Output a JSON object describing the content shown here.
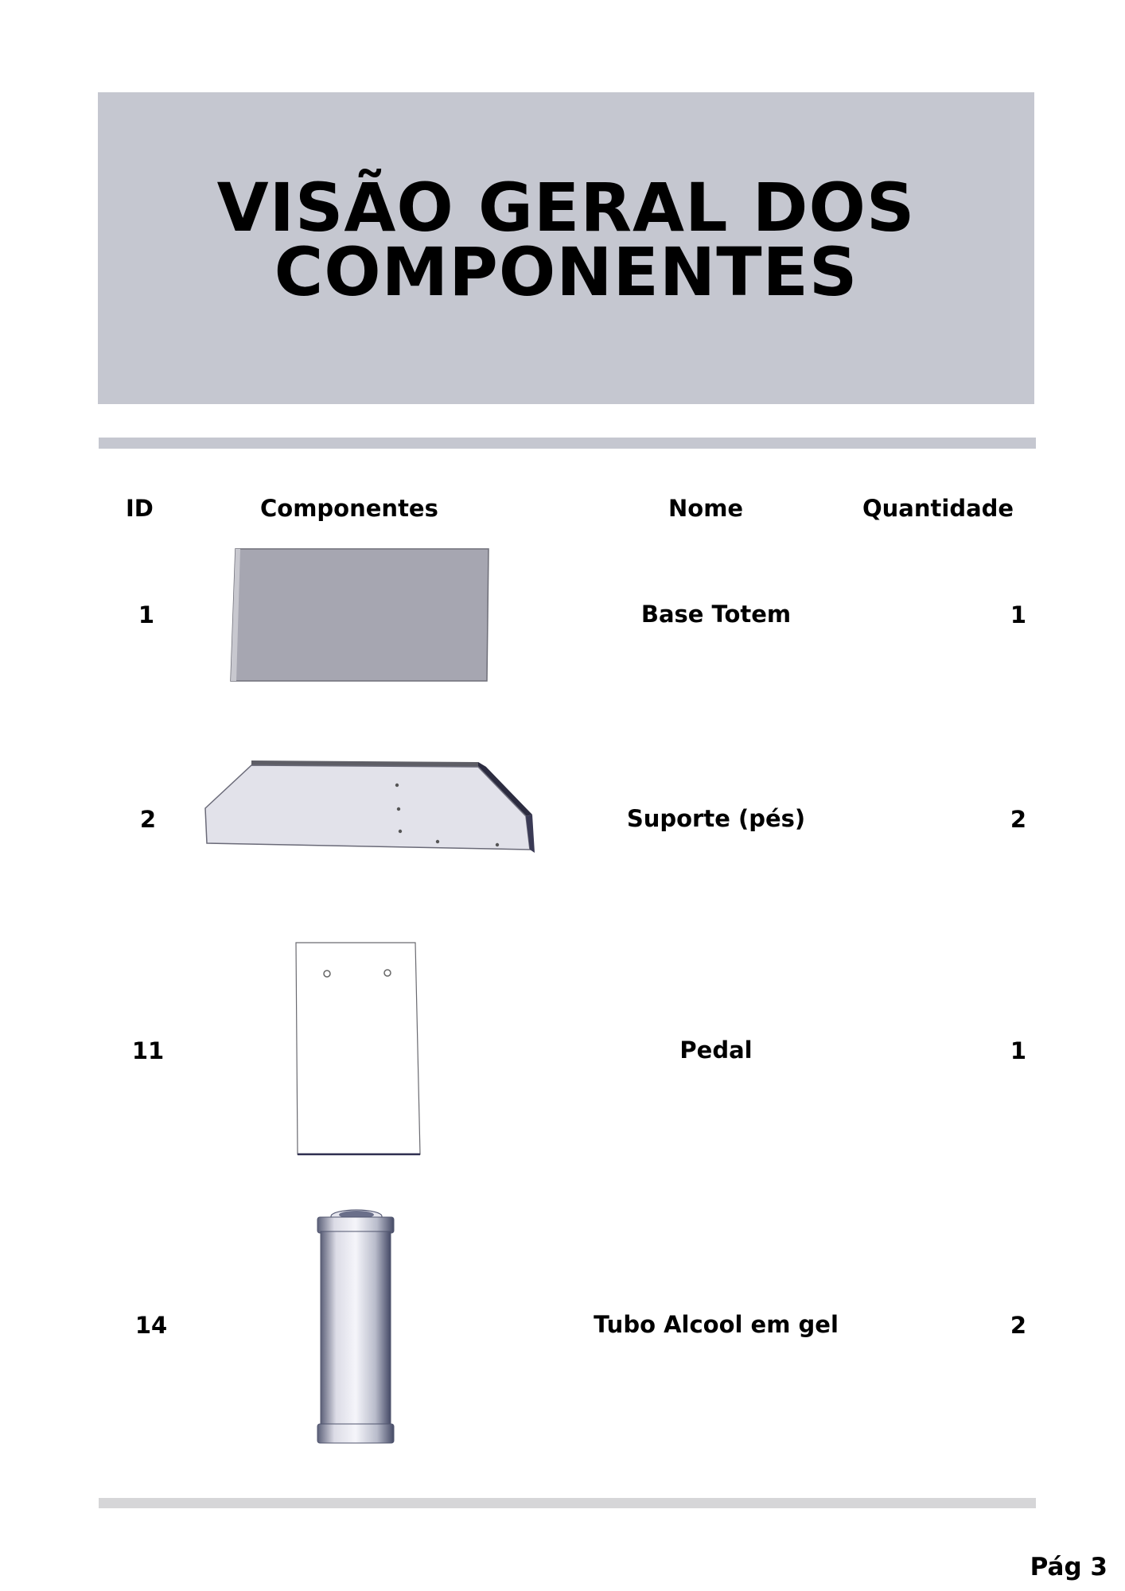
{
  "header": {
    "title_line1": "VISÃO GERAL DOS",
    "title_line2": "COMPONENTES",
    "background": "#c5c7d0"
  },
  "table": {
    "columns": [
      "ID",
      "Componentes",
      "Nome",
      "Quantidade"
    ],
    "rows": [
      {
        "id": "1",
        "name": "Base Totem",
        "qty": "1",
        "image": "base-totem-panel-icon"
      },
      {
        "id": "2",
        "name": "Suporte (pés)",
        "qty": "2",
        "image": "support-feet-bracket-icon"
      },
      {
        "id": "11",
        "name": "Pedal",
        "qty": "1",
        "image": "pedal-plate-icon"
      },
      {
        "id": "14",
        "name": "Tubo Alcool em gel",
        "qty": "2",
        "image": "gel-tube-cylinder-icon"
      }
    ]
  },
  "footer": {
    "page": "Pág 3"
  }
}
